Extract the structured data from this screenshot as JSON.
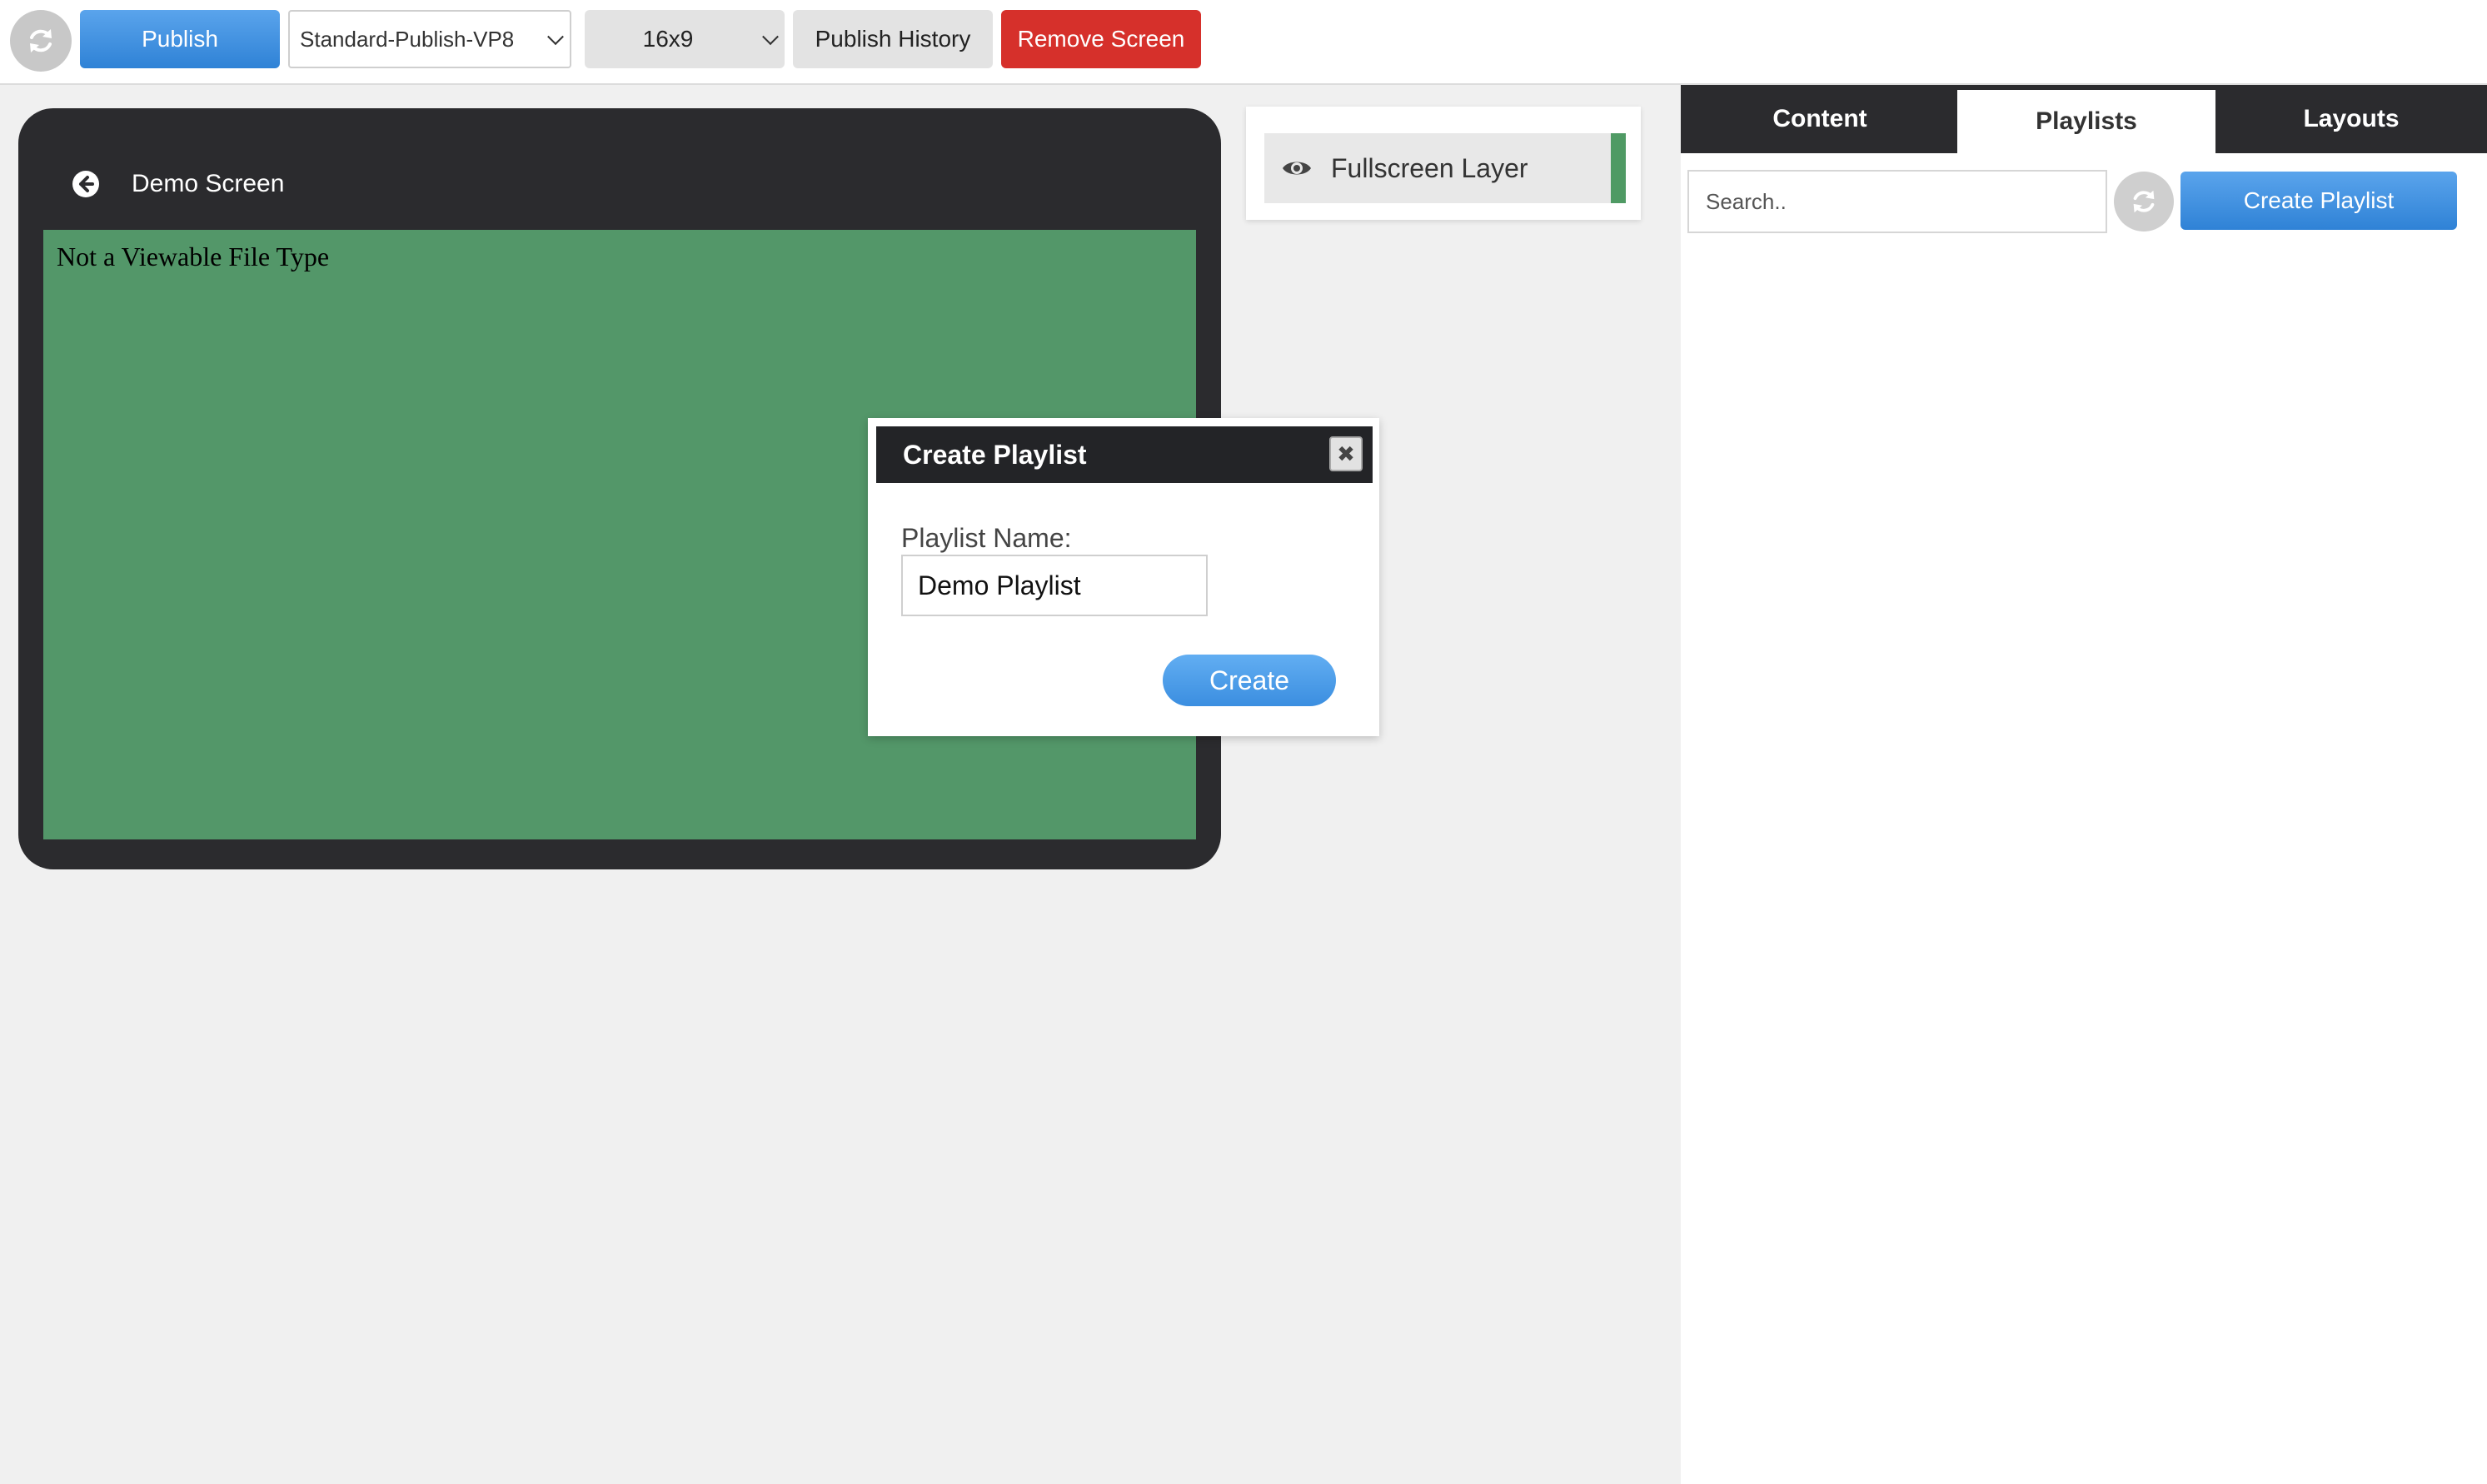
{
  "toolbar": {
    "refresh_icon": "refresh-icon",
    "publish_label": "Publish",
    "publish_profile": "Standard-Publish-VP8",
    "aspect_ratio": "16x9",
    "publish_history_label": "Publish History",
    "remove_screen_label": "Remove Screen",
    "colors": {
      "primary": "#2f82d6",
      "danger": "#d6302b"
    }
  },
  "device": {
    "back_icon": "back-arrow-icon",
    "title": "Demo Screen",
    "screen_message": "Not a Viewable File Type",
    "screen_color": "#539769"
  },
  "layers": {
    "items": [
      {
        "icon": "eye-icon",
        "label": "Fullscreen Layer",
        "color": "#4f9a64"
      }
    ]
  },
  "right_panel": {
    "tabs": [
      {
        "label": "Content",
        "active": false
      },
      {
        "label": "Playlists",
        "active": true
      },
      {
        "label": "Layouts",
        "active": false
      }
    ],
    "search_placeholder": "Search..",
    "refresh_icon": "refresh-icon",
    "create_playlist_label": "Create Playlist"
  },
  "modal": {
    "title": "Create Playlist",
    "close_icon": "close-icon",
    "field_label": "Playlist Name:",
    "field_value": "Demo Playlist",
    "submit_label": "Create"
  }
}
